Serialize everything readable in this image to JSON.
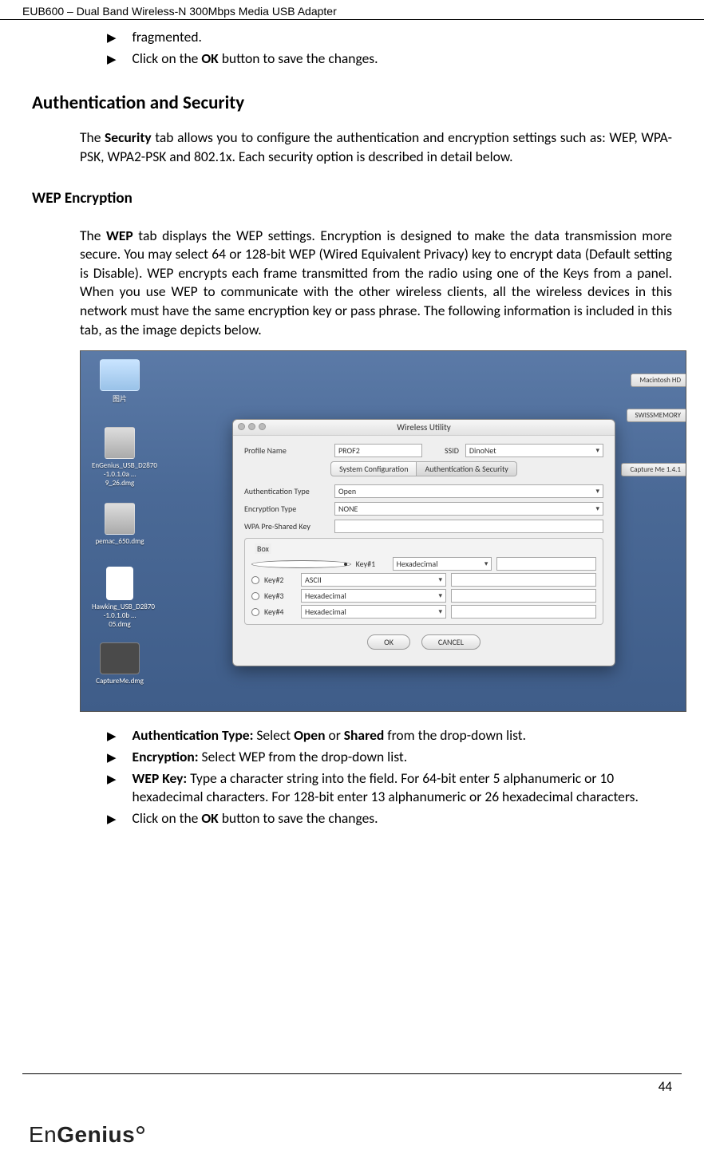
{
  "header": {
    "title": "EUB600 – Dual Band Wireless-N 300Mbps Media USB Adapter"
  },
  "top_bullets": [
    {
      "text": "fragmented."
    },
    {
      "text_html": "Click on the <b>OK</b> button to save the changes."
    }
  ],
  "h1": "Authentication and Security",
  "para1_html": "The <b>Security</b> tab allows you to configure the authentication and encryption settings such as: WEP, WPA-PSK, WPA2-PSK and 802.1x. Each security option is described in detail below.",
  "h2": "WEP Encryption",
  "para2_html": "The <b>WEP</b> tab displays the WEP settings. Encryption is designed to make the data transmission more secure. You may select 64 or 128-bit WEP (Wired Equivalent Privacy) key to encrypt data (Default setting is Disable). WEP encrypts each frame transmitted from the radio using one of the Keys from a panel. When you use WEP to communicate with the other wireless clients, all the wireless devices in this network must have the same encryption key or pass phrase.  The following information is included in this tab, as the image depicts below.",
  "bottom_bullets": [
    {
      "text_html": "<b>Authentication Type:</b> Select <b>Open</b> or <b>Shared</b> from the drop-down list."
    },
    {
      "text_html": "<b>Encryption:</b> Select WEP from the drop-down list."
    },
    {
      "text_html": "<b>WEP Key:</b> Type a character string into the field. For 64-bit enter 5 alphanumeric or 10 hexadecimal characters. For 128-bit enter 13 alphanumeric or 26 hexadecimal characters."
    },
    {
      "text_html": "Click on the <b>OK</b> button to save the changes."
    }
  ],
  "page_number": "44",
  "logo": {
    "prefix": "En",
    "suffix": "Genius"
  },
  "fig": {
    "desktop_icons_left": [
      {
        "name": "blue-folder",
        "label": "图片",
        "cls": "ic"
      },
      {
        "name": "dmg-1",
        "label": "EnGenius_USB_D2870 -1.0.1.0a … 9_26.dmg",
        "cls": "ic disk"
      },
      {
        "name": "dmg-2",
        "label": "pemac_650.dmg",
        "cls": "ic disk"
      },
      {
        "name": "dmg-3",
        "label": "Hawking_USB_D2870 -1.0.1.0b … 05.dmg",
        "cls": "ic file"
      },
      {
        "name": "dmg-4",
        "label": "CaptureMe.dmg",
        "cls": "ic dark"
      }
    ],
    "hd_labels": [
      "Macintosh HD",
      "SWISSMEMORY",
      "Capture Me 1.4.1"
    ],
    "dialog": {
      "title": "Wireless Utility",
      "profile_label": "Profile Name",
      "profile_value": "PROF2",
      "ssid_label": "SSID",
      "ssid_value": "DinoNet",
      "tabs": [
        "System Configuration",
        "Authentication & Security"
      ],
      "active_tab": 1,
      "auth_label": "Authentication Type",
      "auth_value": "Open",
      "enc_label": "Encryption Type",
      "enc_value": "NONE",
      "wpa_label": "WPA Pre-Shared Key",
      "wpa_value": "",
      "group_legend": "Box",
      "keys": [
        {
          "label": "Key#1",
          "format": "Hexadecimal",
          "selected": true
        },
        {
          "label": "Key#2",
          "format": "ASCII",
          "selected": false
        },
        {
          "label": "Key#3",
          "format": "Hexadecimal",
          "selected": false
        },
        {
          "label": "Key#4",
          "format": "Hexadecimal",
          "selected": false
        }
      ],
      "ok": "OK",
      "cancel": "CANCEL"
    }
  }
}
